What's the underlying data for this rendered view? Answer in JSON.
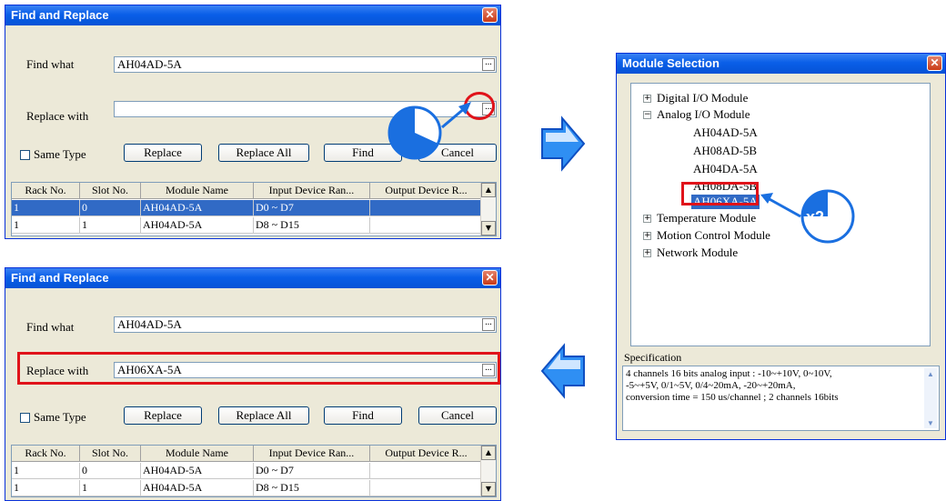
{
  "dialog_top": {
    "title": "Find and Replace",
    "close": "✕",
    "find_what_label": "Find what",
    "find_what_value": "AH04AD-5A",
    "replace_with_label": "Replace with",
    "replace_with_value": "",
    "browse": "...",
    "same_type_label": "Same Type",
    "buttons": {
      "replace": "Replace",
      "replace_all": "Replace All",
      "find": "Find",
      "cancel": "Cancel"
    },
    "columns": [
      "Rack No.",
      "Slot No.",
      "Module Name",
      "Input Device Ran...",
      "Output Device R..."
    ],
    "rows": [
      [
        "1",
        "0",
        "AH04AD-5A",
        "D0 ~ D7",
        ""
      ],
      [
        "1",
        "1",
        "AH04AD-5A",
        "D8 ~ D15",
        ""
      ]
    ],
    "selected_row": 0
  },
  "dialog_bottom": {
    "title": "Find and Replace",
    "close": "✕",
    "find_what_label": "Find what",
    "find_what_value": "AH04AD-5A",
    "replace_with_label": "Replace with",
    "replace_with_value": "AH06XA-5A",
    "browse": "...",
    "same_type_label": "Same Type",
    "buttons": {
      "replace": "Replace",
      "replace_all": "Replace All",
      "find": "Find",
      "cancel": "Cancel"
    },
    "columns": [
      "Rack No.",
      "Slot No.",
      "Module Name",
      "Input Device Ran...",
      "Output Device R..."
    ],
    "rows": [
      [
        "1",
        "0",
        "AH04AD-5A",
        "D0 ~ D7",
        ""
      ],
      [
        "1",
        "1",
        "AH04AD-5A",
        "D8 ~ D15",
        ""
      ]
    ]
  },
  "module_selection": {
    "title": "Module Selection",
    "close": "✕",
    "tree": [
      {
        "label": "Digital I/O Module",
        "expander": "+"
      },
      {
        "label": "Analog I/O Module",
        "expander": "−"
      },
      {
        "label": "AH04AD-5A"
      },
      {
        "label": "AH08AD-5B"
      },
      {
        "label": "AH04DA-5A"
      },
      {
        "label": "AH08DA-5B"
      },
      {
        "label": "AH06XA-5A",
        "selected": true
      },
      {
        "label": "Temperature Module",
        "expander": "+"
      },
      {
        "label": "Motion Control Module",
        "expander": "+"
      },
      {
        "label": "Network Module",
        "expander": "+"
      }
    ],
    "specification_label": "Specification",
    "specification_lines": [
      "4 channels 16 bits analog input : -10~+10V, 0~10V,",
      "-5~+5V, 0/1~5V, 0/4~20mA, -20~+20mA,",
      "conversion time = 150 us/channel ; 2 channels 16bits"
    ]
  },
  "annotations": {
    "double_click_label": "x2",
    "colors": {
      "highlight": "#e0131a",
      "accent": "#1a6fe0",
      "titlebar": "#0a5fe8"
    }
  }
}
